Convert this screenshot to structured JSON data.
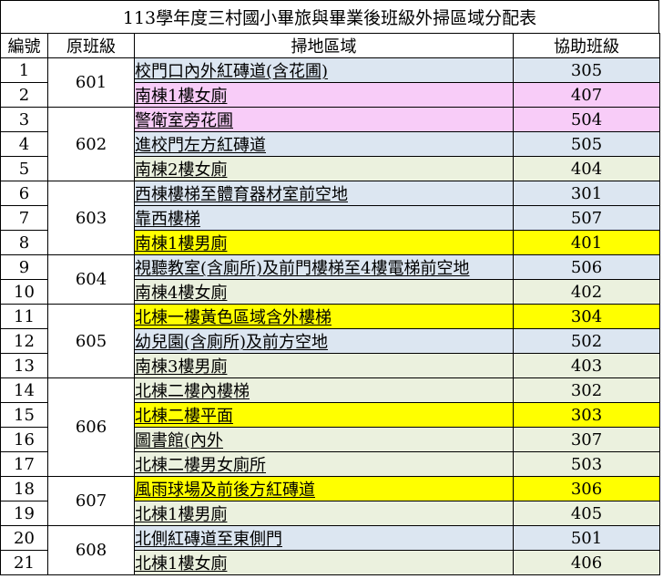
{
  "title": "113學年度三村國小畢旅與畢業後班級外掃區域分配表",
  "headers": {
    "no": "編號",
    "class": "原班級",
    "area": "掃地區域",
    "helper": "協助班級"
  },
  "colors": {
    "blue": "#dce6f1",
    "pink": "#f8ccf8",
    "yellow": "#ffff00",
    "green": "#ebf1de"
  },
  "groups": [
    {
      "class": "601",
      "start": 0,
      "span": 2
    },
    {
      "class": "602",
      "start": 2,
      "span": 3
    },
    {
      "class": "603",
      "start": 5,
      "span": 3
    },
    {
      "class": "604",
      "start": 8,
      "span": 2
    },
    {
      "class": "605",
      "start": 10,
      "span": 3
    },
    {
      "class": "606",
      "start": 13,
      "span": 4
    },
    {
      "class": "607",
      "start": 17,
      "span": 2
    },
    {
      "class": "608",
      "start": 19,
      "span": 2
    }
  ],
  "rows": [
    {
      "no": "1",
      "area": "校門口內外紅磚道(含花圃)",
      "helper": "305",
      "color": "blue"
    },
    {
      "no": "2",
      "area": "南棟1樓女廁",
      "helper": "407",
      "color": "pink"
    },
    {
      "no": "3",
      "area": "警衛室旁花圃",
      "helper": "504",
      "color": "pink"
    },
    {
      "no": "4",
      "area": "進校門左方紅磚道",
      "helper": "505",
      "color": "blue"
    },
    {
      "no": "5",
      "area": "南棟2樓女廁",
      "helper": "404",
      "color": "green"
    },
    {
      "no": "6",
      "area": "西棟樓梯至體育器材室前空地",
      "helper": "301",
      "color": "blue"
    },
    {
      "no": "7",
      "area": "靠西樓梯",
      "helper": "507",
      "color": "blue"
    },
    {
      "no": "8",
      "area": "南棟1樓男廁",
      "helper": "401",
      "color": "yellow"
    },
    {
      "no": "9",
      "area": "視聽教室(含廁所)及前門樓梯至4樓電梯前空地",
      "helper": "506",
      "color": "blue"
    },
    {
      "no": "10",
      "area": "南棟4樓女廁",
      "helper": "402",
      "color": "green"
    },
    {
      "no": "11",
      "area": "北棟一樓黃色區域含外樓梯",
      "helper": "304",
      "color": "yellow"
    },
    {
      "no": "12",
      "area": "幼兒園(含廁所)及前方空地",
      "helper": "502",
      "color": "blue"
    },
    {
      "no": "13",
      "area": "南棟3樓男廁",
      "helper": "403",
      "color": "green"
    },
    {
      "no": "14",
      "area": "北棟二樓內樓梯",
      "helper": "302",
      "color": "green"
    },
    {
      "no": "15",
      "area": "北棟二樓平面",
      "helper": "303",
      "color": "yellow"
    },
    {
      "no": "16",
      "area": "圖書館(內外",
      "helper": "307",
      "color": "green"
    },
    {
      "no": "17",
      "area": "北棟二樓男女廁所",
      "helper": "503",
      "color": "green"
    },
    {
      "no": "18",
      "area": "風雨球場及前後方紅磚道",
      "helper": "306",
      "color": "yellow"
    },
    {
      "no": "19",
      "area": "北棟1樓男廁",
      "helper": "405",
      "color": "green"
    },
    {
      "no": "20",
      "area": "北側紅磚道至東側門",
      "helper": "501",
      "color": "blue"
    },
    {
      "no": "21",
      "area": "北棟1樓女廁",
      "helper": "406",
      "color": "green"
    }
  ]
}
